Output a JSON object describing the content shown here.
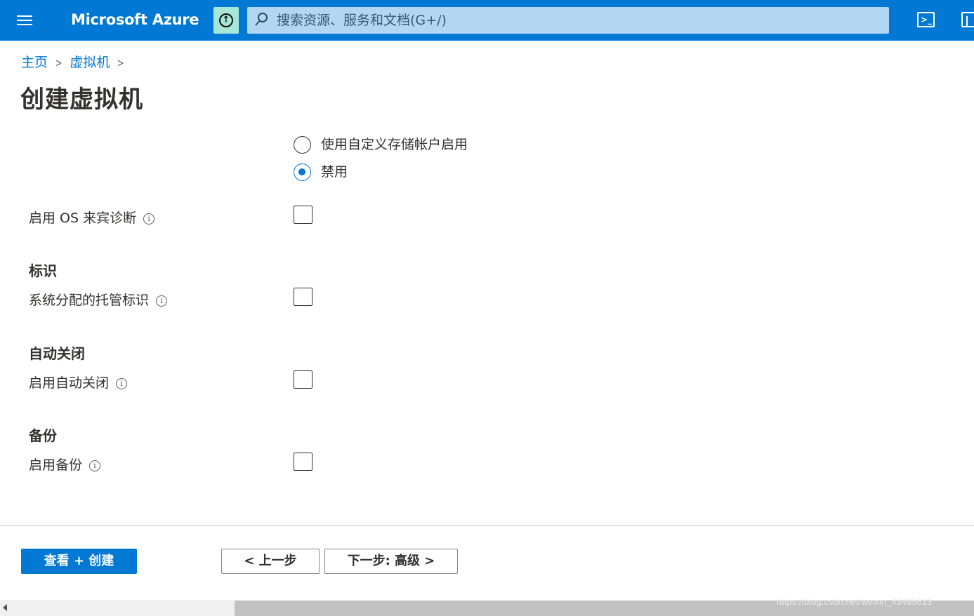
{
  "header": {
    "brand": "Microsoft Azure",
    "search_placeholder": "搜索资源、服务和文档(G+/)",
    "shell_glyph": ">_"
  },
  "breadcrumb": {
    "items": [
      "主页",
      "虚拟机"
    ]
  },
  "page_title": "创建虚拟机",
  "boot_diagnostics": {
    "options": [
      {
        "label": "使用自定义存储帐户启用",
        "selected": false
      },
      {
        "label": "禁用",
        "selected": true
      }
    ]
  },
  "fields": {
    "os_guest_diag": {
      "label": "启用 OS 来宾诊断",
      "checked": false
    },
    "identity_heading": "标识",
    "managed_identity": {
      "label": "系统分配的托管标识",
      "checked": false
    },
    "autoshutdown_heading": "自动关闭",
    "autoshutdown": {
      "label": "启用自动关闭",
      "checked": false
    },
    "backup_heading": "备份",
    "backup": {
      "label": "启用备份",
      "checked": false
    }
  },
  "info_glyph": "i",
  "footer": {
    "review_create": "查看 + 创建",
    "previous": "< 上一步",
    "next": "下一步: 高级 >"
  },
  "watermark": "https://blog.csdn.net/weixin_43495813",
  "colors": {
    "accent": "#0078d4",
    "upload_bg": "#a6e7d9",
    "search_bg": "#b3d7f2"
  }
}
